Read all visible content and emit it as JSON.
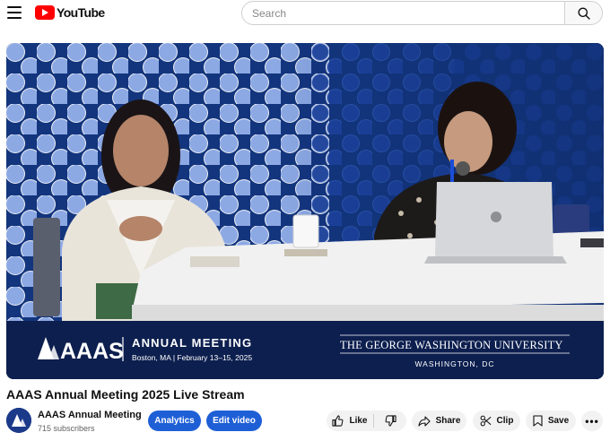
{
  "header": {
    "logo_text": "YouTube",
    "search_placeholder": "Search"
  },
  "video": {
    "banner": {
      "aaas": "AAAS",
      "meeting_title": "ANNUAL MEETING",
      "meeting_sub": "Boston, MA  |  February 13–15, 2025",
      "university": "THE GEORGE WASHINGTON UNIVERSITY",
      "university_sub": "WASHINGTON, DC"
    }
  },
  "title": "AAAS Annual Meeting 2025 Live Stream",
  "channel": {
    "name": "AAAS Annual Meeting",
    "subscribers": "715 subscribers"
  },
  "actions": {
    "analytics": "Analytics",
    "edit_video": "Edit video",
    "like": "Like",
    "share": "Share",
    "clip": "Clip",
    "save": "Save",
    "more": "•••"
  },
  "colors": {
    "brand_red": "#ff0000",
    "primary_blue": "#1f5fd6",
    "banner_navy": "#0d1f4f"
  }
}
